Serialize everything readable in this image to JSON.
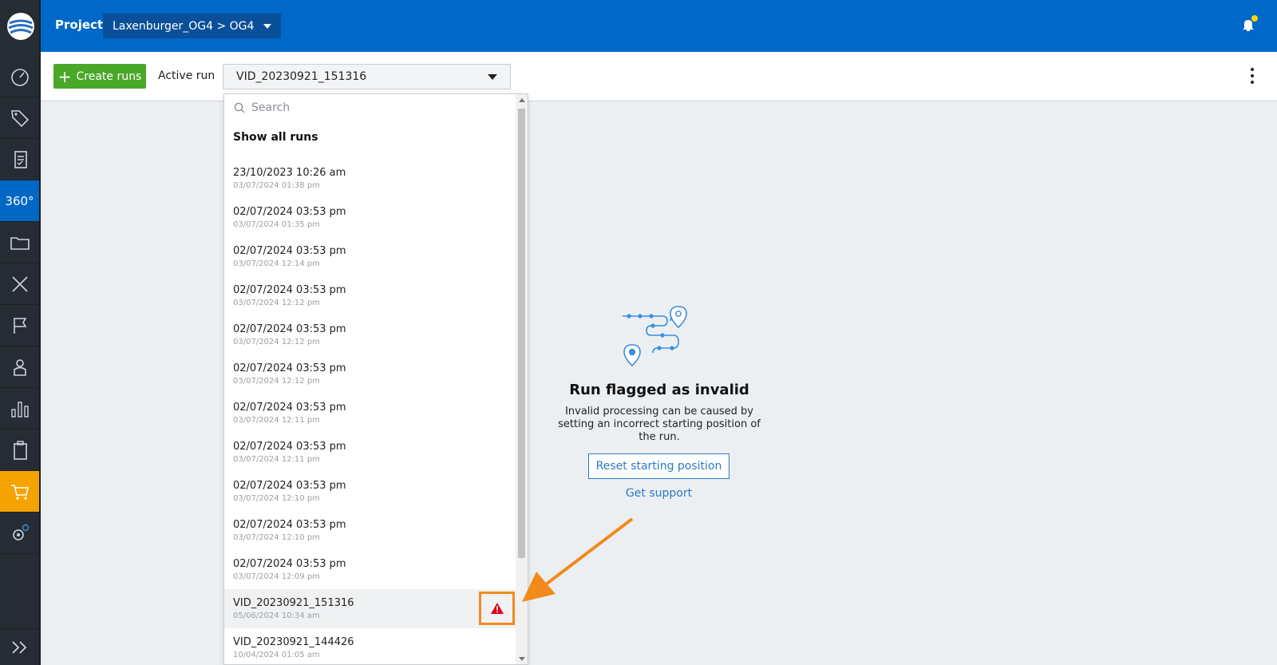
{
  "topbar": {
    "project_label": "Project",
    "project_value": "Laxenburger_OG4 > OG4"
  },
  "sidebar": {
    "items": [
      {
        "icon": "gauge-icon"
      },
      {
        "icon": "tag-icon"
      },
      {
        "icon": "checklist-icon"
      },
      {
        "label": "360°",
        "icon": "360-icon",
        "active": true
      },
      {
        "icon": "folder-icon"
      },
      {
        "icon": "ruler-pencil-icon"
      },
      {
        "icon": "flag-icon"
      },
      {
        "icon": "person-icon"
      },
      {
        "icon": "bar-chart-icon"
      },
      {
        "icon": "clipboard-icon"
      },
      {
        "icon": "cart-icon",
        "highlight": true
      },
      {
        "icon": "settings-icon"
      }
    ]
  },
  "toolbar": {
    "create_label": "Create runs",
    "active_run_label": "Active run",
    "active_run_value": "VID_20230921_151316"
  },
  "dropdown": {
    "search_placeholder": "Search",
    "show_all": "Show all runs",
    "items": [
      {
        "title": "23/10/2023 10:26 am",
        "sub": "03/07/2024 01:38 pm"
      },
      {
        "title": "02/07/2024 03:53 pm",
        "sub": "03/07/2024 01:35 pm"
      },
      {
        "title": "02/07/2024 03:53 pm",
        "sub": "03/07/2024 12:14 pm"
      },
      {
        "title": "02/07/2024 03:53 pm",
        "sub": "03/07/2024 12:12 pm"
      },
      {
        "title": "02/07/2024 03:53 pm",
        "sub": "03/07/2024 12:12 pm"
      },
      {
        "title": "02/07/2024 03:53 pm",
        "sub": "03/07/2024 12:12 pm"
      },
      {
        "title": "02/07/2024 03:53 pm",
        "sub": "03/07/2024 12:11 pm"
      },
      {
        "title": "02/07/2024 03:53 pm",
        "sub": "03/07/2024 12:11 pm"
      },
      {
        "title": "02/07/2024 03:53 pm",
        "sub": "03/07/2024 12:10 pm"
      },
      {
        "title": "02/07/2024 03:53 pm",
        "sub": "03/07/2024 12:10 pm"
      },
      {
        "title": "02/07/2024 03:53 pm",
        "sub": "03/07/2024 12:09 pm"
      },
      {
        "title": "VID_20230921_151316",
        "sub": "05/06/2024 10:34 am",
        "selected": true,
        "warning": true
      },
      {
        "title": "VID_20230921_144426",
        "sub": "10/04/2024 01:05 am"
      }
    ]
  },
  "empty_state": {
    "title": "Run flagged as invalid",
    "text": "Invalid processing can be caused by setting an incorrect starting position of the run.",
    "reset_button": "Reset starting position",
    "support_link": "Get support"
  },
  "colors": {
    "topbar": "#0068c8",
    "sidebar": "#262c33",
    "accent_green": "#4aa829",
    "highlight_orange": "#f5a300",
    "warning_red": "#e0001b",
    "annotation_orange": "#f28a1c",
    "link_blue": "#2b7bc4"
  }
}
